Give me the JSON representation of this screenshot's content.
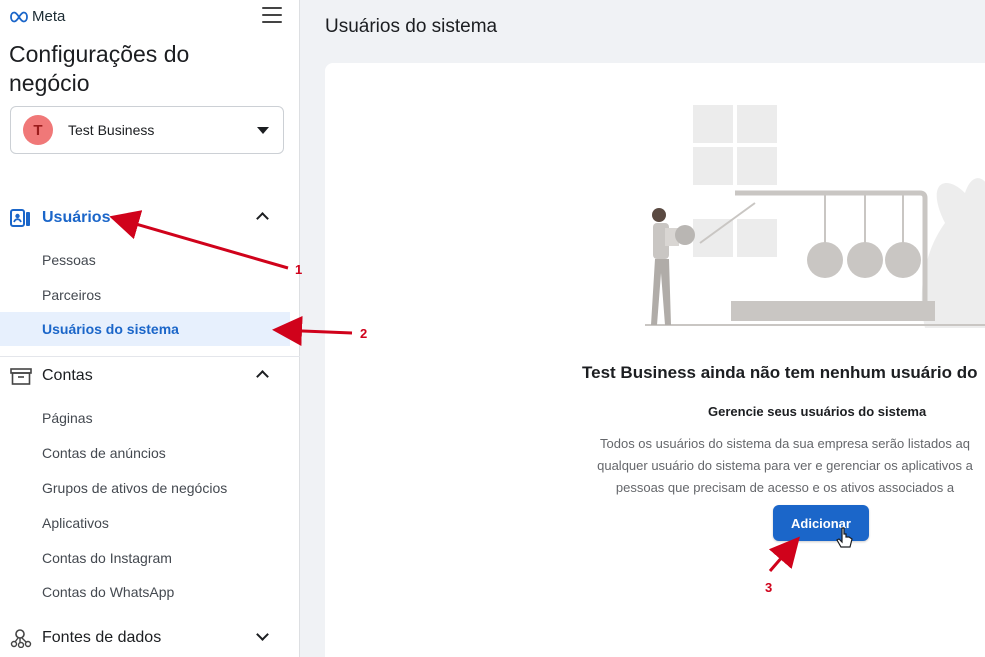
{
  "brand": {
    "logo_text": "Meta"
  },
  "sidebar": {
    "title": "Configurações do negócio",
    "business": {
      "initial": "T",
      "name": "Test Business"
    },
    "sections": [
      {
        "label": "Usuários",
        "expanded": true,
        "items": [
          "Pessoas",
          "Parceiros",
          "Usuários do sistema"
        ]
      },
      {
        "label": "Contas",
        "expanded": true,
        "items": [
          "Páginas",
          "Contas de anúncios",
          "Grupos de ativos de negócios",
          "Aplicativos",
          "Contas do Instagram",
          "Contas do WhatsApp"
        ]
      },
      {
        "label": "Fontes de dados",
        "expanded": false,
        "items": []
      }
    ],
    "active_item": "Usuários do sistema"
  },
  "main": {
    "page_title": "Usuários do sistema",
    "empty_state": {
      "title": "Test Business ainda não tem nenhum usuário do",
      "subtitle": "Gerencie seus usuários do sistema",
      "description_lines": [
        "Todos os usuários do sistema da sua empresa serão listados aq",
        "qualquer usuário do sistema para ver e gerenciar os aplicativos a",
        "pessoas que precisam de acesso e os ativos associados a"
      ],
      "add_button": "Adicionar"
    }
  },
  "annotations": {
    "step1": "1",
    "step2": "2",
    "step3": "3",
    "color": "#d0021b"
  },
  "colors": {
    "accent": "#1b66c9",
    "active_bg": "#e7f0fd",
    "avatar": "#f07878"
  }
}
